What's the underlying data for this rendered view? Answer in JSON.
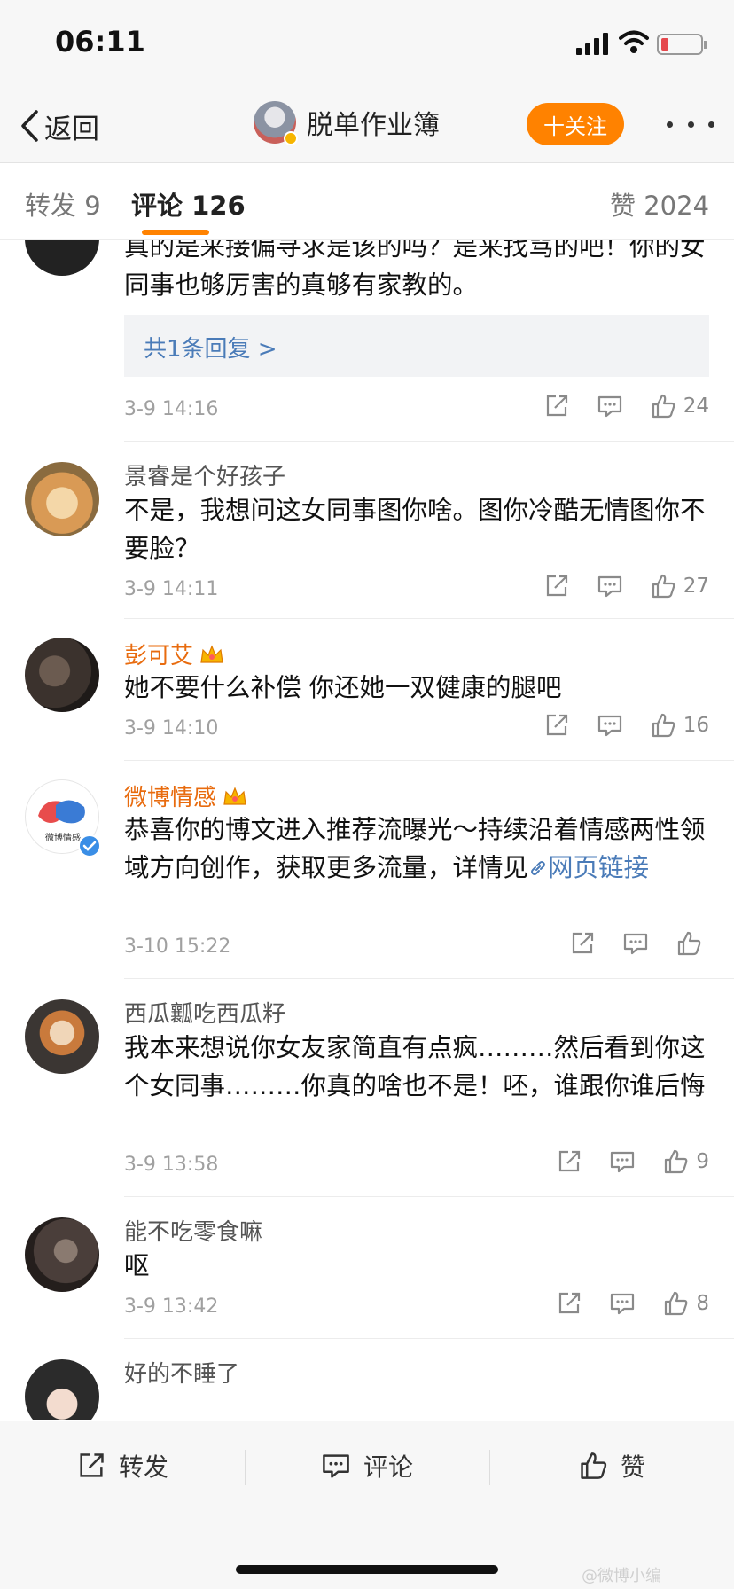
{
  "status": {
    "time": "06:11"
  },
  "nav": {
    "back": "返回",
    "title": "脱单作业簿",
    "follow": "十关注"
  },
  "tabs": {
    "repost": "转发 9",
    "comment": "评论 126",
    "like": "赞 2024"
  },
  "comments": [
    {
      "text": "真的是来接偏寻求是该的吗？是来找骂的吧！你的女同事也够厉害的真够有家教的。",
      "reply": "共1条回复 >",
      "time": "3-9 14:16",
      "likes": "24"
    },
    {
      "name": "景睿是个好孩子",
      "text": "不是，我想问这女同事图你啥。图你冷酷无情图你不要脸？",
      "time": "3-9 14:11",
      "likes": "27"
    },
    {
      "name": "彭可艾",
      "text": "她不要什么补偿 你还她一双健康的腿吧",
      "time": "3-9 14:10",
      "likes": "16"
    },
    {
      "name": "微博情感",
      "text": "恭喜你的博文进入推荐流曝光～持续沿着情感两性领域方向创作，获取更多流量，详情见",
      "link": "网页链接",
      "avatar_label": "微博情感",
      "time": "3-10 15:22",
      "likes": ""
    },
    {
      "name": "西瓜瓤吃西瓜籽",
      "text": "我本来想说你女友家简直有点疯………然后看到你这个女同事………你真的啥也不是！呸，谁跟你谁后悔",
      "time": "3-9 13:58",
      "likes": "9"
    },
    {
      "name": "能不吃零食嘛",
      "text": "呕",
      "time": "3-9 13:42",
      "likes": "8"
    },
    {
      "name": "好的不睡了"
    }
  ],
  "bottom": {
    "repost": "转发",
    "comment": "评论",
    "like": "赞"
  },
  "watermark": "@微博小编"
}
